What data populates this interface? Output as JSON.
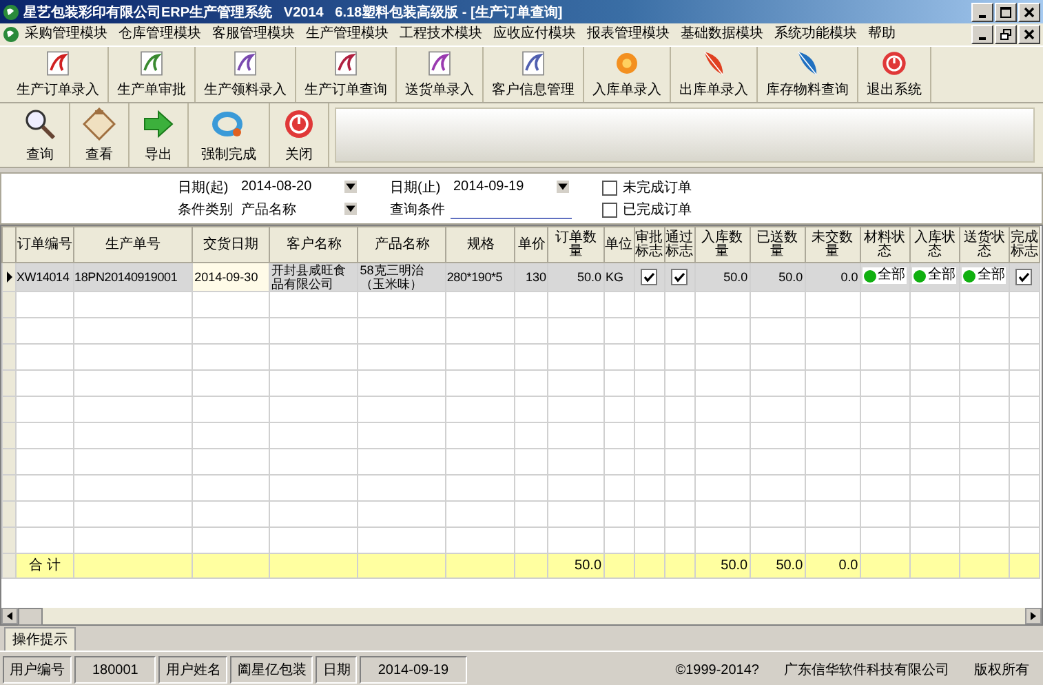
{
  "window": {
    "title": "星艺包装彩印有限公司ERP生产管理系统   V2014   6.18塑料包装高级版 - [生产订单查询]"
  },
  "menu": [
    "采购管理模块",
    "仓库管理模块",
    "客服管理模块",
    "生产管理模块",
    "工程技术模块",
    "应收应付模块",
    "报表管理模块",
    "基础数据模块",
    "系统功能模块",
    "帮助"
  ],
  "main_toolbar": [
    "生产订单录入",
    "生产单审批",
    "生产领料录入",
    "生产订单查询",
    "送货单录入",
    "客户信息管理",
    "入库单录入",
    "出库单录入",
    "库存物料查询",
    "退出系统"
  ],
  "page_toolbar": [
    "查询",
    "查看",
    "导出",
    "强制完成",
    "关闭"
  ],
  "filters": {
    "date_from": {
      "label": "日期(起)",
      "value": "2014-08-20"
    },
    "date_to": {
      "label": "日期(止)",
      "value": "2014-09-19"
    },
    "condition_type": {
      "label": "条件类别",
      "value": "产品名称"
    },
    "condition": {
      "label": "查询条件"
    },
    "checkboxes": [
      {
        "label": "未完成订单",
        "checked": false
      },
      {
        "label": "已完成订单",
        "checked": false
      }
    ]
  },
  "grid": {
    "columns": [
      {
        "label": "订单编号",
        "kind": "text"
      },
      {
        "label": "生产单号",
        "kind": "text"
      },
      {
        "label": "交货日期",
        "kind": "date"
      },
      {
        "label": "客户名称",
        "kind": "text"
      },
      {
        "label": "产品名称",
        "kind": "text"
      },
      {
        "label": "规格",
        "kind": "text"
      },
      {
        "label": "单价",
        "kind": "number"
      },
      {
        "label": "订单数量",
        "kind": "number",
        "total": "50.0"
      },
      {
        "label": "单位",
        "kind": "text"
      },
      {
        "label": "审批标志",
        "kind": "check"
      },
      {
        "label": "通过标志",
        "kind": "check"
      },
      {
        "label": "入库数量",
        "kind": "number",
        "total": "50.0"
      },
      {
        "label": "已送数量",
        "kind": "number",
        "total": "50.0"
      },
      {
        "label": "未交数量",
        "kind": "number",
        "total": "0.0"
      },
      {
        "label": "材料状态",
        "kind": "status"
      },
      {
        "label": "入库状态",
        "kind": "status"
      },
      {
        "label": "送货状态",
        "kind": "status"
      },
      {
        "label": "完成标志",
        "kind": "check"
      }
    ],
    "rows": [
      {
        "selected": true,
        "cells": [
          {
            "text": "XW14014"
          },
          {
            "text": "18PN20140919001"
          },
          {
            "text": "2014-09-30"
          },
          {
            "text": "开封县咸旺食品有限公司"
          },
          {
            "text": "58克三明治（玉米味）"
          },
          {
            "text": "280*190*5"
          },
          {
            "text": "130"
          },
          {
            "text": "50.0"
          },
          {
            "text": "KG"
          },
          {
            "checked": true
          },
          {
            "checked": true
          },
          {
            "text": "50.0"
          },
          {
            "text": "50.0"
          },
          {
            "text": "0.0"
          },
          {
            "color": "#10b010",
            "text": "全部"
          },
          {
            "color": "#10b010",
            "text": "全部"
          },
          {
            "color": "#10b010",
            "text": "全部"
          },
          {
            "checked": true
          }
        ]
      }
    ],
    "totals_label": "合 计"
  },
  "hint_tab": "操作提示",
  "status_bar": [
    {
      "text": "用户编号",
      "kind": "label"
    },
    {
      "text": "180001",
      "kind": "value"
    },
    {
      "text": "用户姓名",
      "kind": "label"
    },
    {
      "text": "阖星亿包装",
      "kind": "label"
    },
    {
      "text": "日期",
      "kind": "label"
    },
    {
      "text": "2014-09-19",
      "kind": "value"
    },
    {
      "text": "©1999-2014?",
      "kind": "wide"
    },
    {
      "text": "广东信华软件科技有限公司",
      "kind": "wide"
    },
    {
      "text": "版权所有",
      "kind": "wide"
    }
  ]
}
